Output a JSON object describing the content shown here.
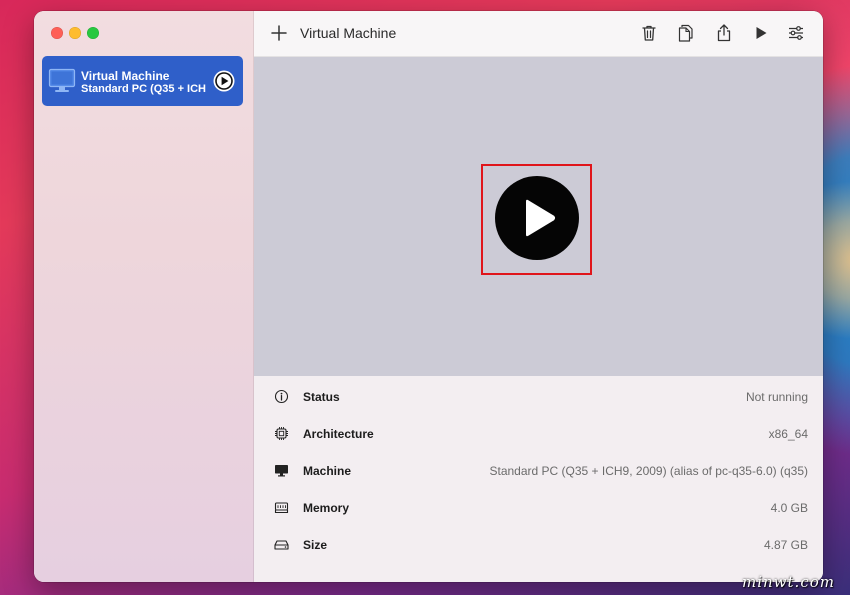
{
  "colors": {
    "accent": "#2f5fc9",
    "highlight_box": "#e0151b",
    "display_bg": "#cccbd6",
    "traffic_close": "#fe5f57",
    "traffic_minimize": "#febc2e",
    "traffic_maximize": "#28c840"
  },
  "sidebar": {
    "vm_list": [
      {
        "name": "Virtual Machine",
        "subtitle": "Standard PC (Q35 + ICH...",
        "icon": "monitor-icon",
        "action_icon": "play-circle-icon",
        "selected": true
      }
    ]
  },
  "toolbar": {
    "title": "Virtual Machine",
    "icons": [
      "plus-icon",
      "trash-icon",
      "clone-icon",
      "share-icon",
      "play-icon",
      "sliders-icon"
    ]
  },
  "display": {
    "state": "stopped",
    "play_button_icon": "play-circle-icon"
  },
  "details": [
    {
      "label": "Status",
      "value": "Not running",
      "icon": "info-circle-icon"
    },
    {
      "label": "Architecture",
      "value": "x86_64",
      "icon": "cpu-icon"
    },
    {
      "label": "Machine",
      "value": "Standard PC (Q35 + ICH9, 2009) (alias of pc-q35-6.0) (q35)",
      "icon": "display-icon"
    },
    {
      "label": "Memory",
      "value": "4.0 GB",
      "icon": "memory-icon"
    },
    {
      "label": "Size",
      "value": "4.87 GB",
      "icon": "drive-icon"
    }
  ],
  "watermark": "minwt.com"
}
